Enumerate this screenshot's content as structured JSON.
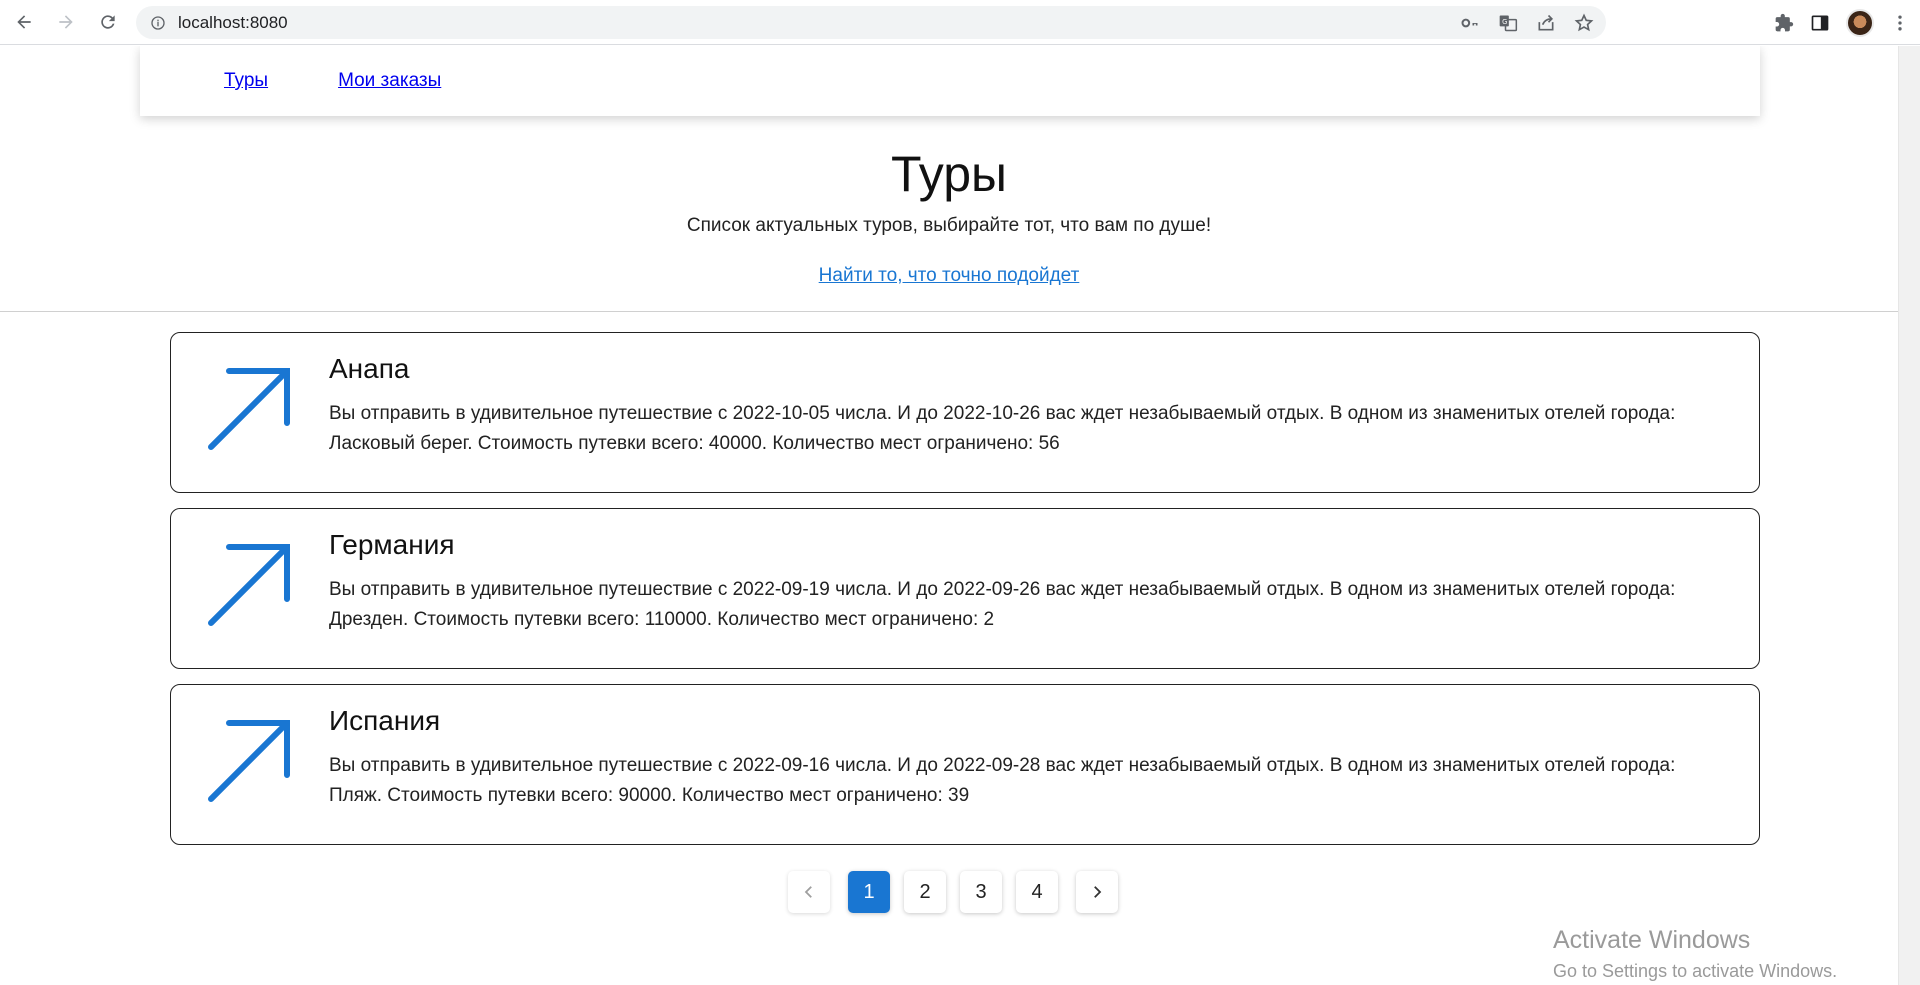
{
  "browser": {
    "url": "localhost:8080"
  },
  "nav": {
    "links": [
      "Туры",
      "Мои заказы"
    ]
  },
  "hero": {
    "title": "Туры",
    "subtitle": "Список актуальных туров, выбирайте тот, что вам по душе!",
    "find_link": "Найти то, что точно подойдет"
  },
  "tours": [
    {
      "title": "Анапа",
      "description": "Вы отправить в удивительное путешествие с 2022-10-05 числа. И до 2022-10-26 вас ждет незабываемый отдых. В одном из знаменитых отелей города: Ласковый берег. Стоимость путевки всего: 40000. Количество мест ограничено: 56"
    },
    {
      "title": "Германия",
      "description": "Вы отправить в удивительное путешествие с 2022-09-19 числа. И до 2022-09-26 вас ждет незабываемый отдых. В одном из знаменитых отелей города: Дрезден. Стоимость путевки всего: 110000. Количество мест ограничено: 2"
    },
    {
      "title": "Испания",
      "description": "Вы отправить в удивительное путешествие с 2022-09-16 числа. И до 2022-09-28 вас ждет незабываемый отдых. В одном из знаменитых отелей города: Пляж. Стоимость путевки всего: 90000. Количество мест ограничено: 39"
    }
  ],
  "pagination": {
    "pages": [
      "1",
      "2",
      "3",
      "4"
    ],
    "current": "1"
  },
  "watermark": {
    "line1": "Activate Windows",
    "line2": "Go to Settings to activate Windows."
  },
  "colors": {
    "accent": "#1976d2",
    "link": "#0000ee"
  }
}
